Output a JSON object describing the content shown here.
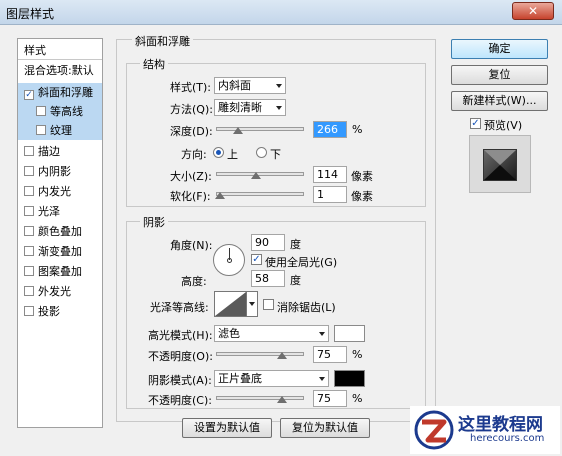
{
  "window": {
    "title": "图层样式",
    "close_symbol": "✕"
  },
  "left_panel": {
    "items": [
      {
        "label": "样式",
        "checkbox": false,
        "checked": false,
        "selected": false,
        "indent": false
      },
      {
        "label": "混合选项:默认",
        "checkbox": false,
        "checked": false,
        "selected": false,
        "indent": false
      },
      {
        "label": "斜面和浮雕",
        "checkbox": true,
        "checked": true,
        "selected": true,
        "indent": false
      },
      {
        "label": "等高线",
        "checkbox": true,
        "checked": false,
        "selected": true,
        "indent": true
      },
      {
        "label": "纹理",
        "checkbox": true,
        "checked": false,
        "selected": true,
        "indent": true
      },
      {
        "label": "描边",
        "checkbox": true,
        "checked": false,
        "selected": false,
        "indent": false
      },
      {
        "label": "内阴影",
        "checkbox": true,
        "checked": false,
        "selected": false,
        "indent": false
      },
      {
        "label": "内发光",
        "checkbox": true,
        "checked": false,
        "selected": false,
        "indent": false
      },
      {
        "label": "光泽",
        "checkbox": true,
        "checked": false,
        "selected": false,
        "indent": false
      },
      {
        "label": "颜色叠加",
        "checkbox": true,
        "checked": false,
        "selected": false,
        "indent": false
      },
      {
        "label": "渐变叠加",
        "checkbox": true,
        "checked": false,
        "selected": false,
        "indent": false
      },
      {
        "label": "图案叠加",
        "checkbox": true,
        "checked": false,
        "selected": false,
        "indent": false
      },
      {
        "label": "外发光",
        "checkbox": true,
        "checked": false,
        "selected": false,
        "indent": false
      },
      {
        "label": "投影",
        "checkbox": true,
        "checked": false,
        "selected": false,
        "indent": false
      }
    ]
  },
  "bevel": {
    "section_title": "斜面和浮雕",
    "structure_title": "结构",
    "style_label": "样式(T):",
    "style_value": "内斜面",
    "technique_label": "方法(Q):",
    "technique_value": "雕刻清晰",
    "depth_label": "深度(D):",
    "depth_value": "266",
    "depth_unit": "%",
    "depth_slider_fraction": 0.25,
    "direction_label": "方向:",
    "direction_up": "上",
    "direction_down": "下",
    "direction_selected": "up",
    "size_label": "大小(Z):",
    "size_value": "114",
    "size_unit": "像素",
    "size_slider_fraction": 0.46,
    "soften_label": "软化(F):",
    "soften_value": "1",
    "soften_unit": "像素",
    "soften_slider_fraction": 0.05
  },
  "shading": {
    "title": "阴影",
    "angle_label": "角度(N):",
    "angle_value": "90",
    "angle_unit": "度",
    "global_light_label": "使用全局光(G)",
    "global_light_checked": true,
    "altitude_label": "高度:",
    "altitude_value": "58",
    "altitude_unit": "度",
    "gloss_contour_label": "光泽等高线:",
    "antialias_label": "消除锯齿(L)",
    "antialias_checked": false,
    "highlight_mode_label": "高光模式(H):",
    "highlight_mode_value": "滤色",
    "highlight_color": "#ffffff",
    "highlight_opacity_label": "不透明度(O):",
    "highlight_opacity_value": "75",
    "highlight_opacity_unit": "%",
    "highlight_opacity_fraction": 0.75,
    "shadow_mode_label": "阴影模式(A):",
    "shadow_mode_value": "正片叠底",
    "shadow_color": "#000000",
    "shadow_opacity_label": "不透明度(C):",
    "shadow_opacity_value": "75",
    "shadow_opacity_unit": "%",
    "shadow_opacity_fraction": 0.75
  },
  "bottom_buttons": {
    "set_default": "设置为默认值",
    "reset_default": "复位为默认值"
  },
  "right_buttons": {
    "ok": "确定",
    "reset": "复位",
    "new_style": "新建样式(W)...",
    "preview_label": "预览(V)",
    "preview_checked": true
  },
  "watermark": {
    "title": "这里教程网",
    "url": "herecours.com"
  }
}
